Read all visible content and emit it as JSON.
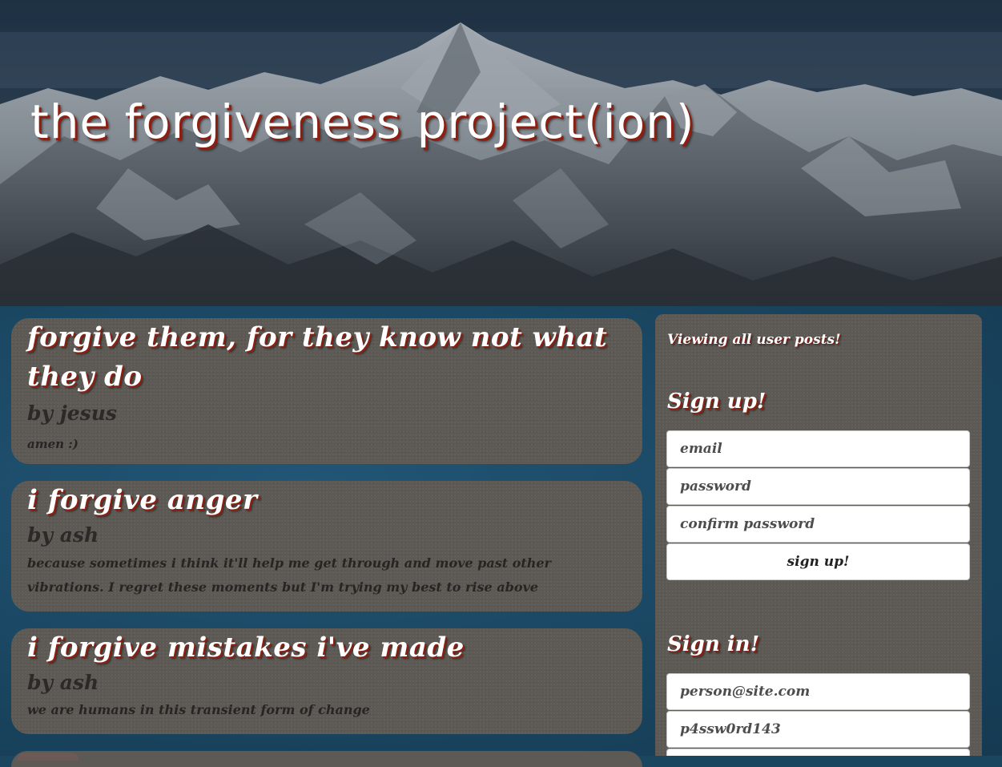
{
  "site": {
    "title": "the forgiveness project(ion)"
  },
  "posts": [
    {
      "title": "forgive them, for they know not what they do",
      "author": "by jesus",
      "body": "amen :)"
    },
    {
      "title": "i forgive anger",
      "author": "by ash",
      "body": "because sometimes i think it'll help me get through and move past other vibrations. I regret these moments but I'm trying my best to rise above"
    },
    {
      "title": "i forgive mistakes i've made",
      "author": "by ash",
      "body": "we are humans in this transient form of change"
    }
  ],
  "sidebar": {
    "note": "Viewing all user posts!",
    "signup": {
      "heading": "Sign up!",
      "email_placeholder": "email",
      "password_placeholder": "password",
      "confirm_placeholder": "confirm password",
      "button_label": "sign up!"
    },
    "signin": {
      "heading": "Sign in!",
      "email_placeholder": "person@site.com",
      "password_placeholder": "p4ssw0rd143"
    }
  },
  "colors": {
    "accent_shadow": "#8b1f12",
    "card": "#5d5954",
    "page_bg": "#1a4660"
  },
  "icons": {
    "header_background": "mountain-range-image"
  }
}
